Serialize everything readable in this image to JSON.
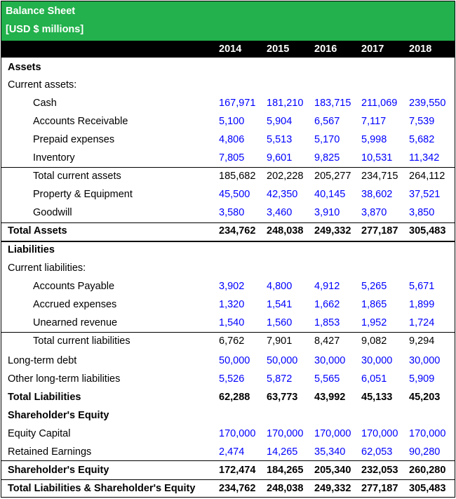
{
  "header": {
    "title": "Balance Sheet",
    "subtitle": "[USD $ millions]",
    "years": [
      "2014",
      "2015",
      "2016",
      "2017",
      "2018"
    ]
  },
  "rows": [
    {
      "label": "Assets",
      "indent": 0,
      "bold": true,
      "blue": false,
      "values": []
    },
    {
      "label": "Current assets:",
      "indent": 0,
      "bold": false,
      "blue": false,
      "values": []
    },
    {
      "label": "Cash",
      "indent": 2,
      "bold": false,
      "blue": true,
      "values": [
        "167,971",
        "181,210",
        "183,715",
        "211,069",
        "239,550"
      ]
    },
    {
      "label": "Accounts Receivable",
      "indent": 2,
      "bold": false,
      "blue": true,
      "values": [
        "5,100",
        "5,904",
        "6,567",
        "7,117",
        "7,539"
      ]
    },
    {
      "label": "Prepaid expenses",
      "indent": 2,
      "bold": false,
      "blue": true,
      "values": [
        "4,806",
        "5,513",
        "5,170",
        "5,998",
        "5,682"
      ]
    },
    {
      "label": "Inventory",
      "indent": 2,
      "bold": false,
      "blue": true,
      "values": [
        "7,805",
        "9,601",
        "9,825",
        "10,531",
        "11,342"
      ]
    },
    {
      "label": "Total current assets",
      "indent": 2,
      "bold": false,
      "blue": false,
      "values": [
        "185,682",
        "202,228",
        "205,277",
        "234,715",
        "264,112"
      ]
    },
    {
      "label": "Property & Equipment",
      "indent": 2,
      "bold": false,
      "blue": true,
      "values": [
        "45,500",
        "42,350",
        "40,145",
        "38,602",
        "37,521"
      ]
    },
    {
      "label": "Goodwill",
      "indent": 2,
      "bold": false,
      "blue": true,
      "values": [
        "3,580",
        "3,460",
        "3,910",
        "3,870",
        "3,850"
      ]
    },
    {
      "label": "Total Assets",
      "indent": 0,
      "bold": true,
      "blue": false,
      "values": [
        "234,762",
        "248,038",
        "249,332",
        "277,187",
        "305,483"
      ]
    },
    {
      "label": "Liabilities",
      "indent": 0,
      "bold": true,
      "blue": false,
      "values": []
    },
    {
      "label": "Current liabilities:",
      "indent": 0,
      "bold": false,
      "blue": false,
      "values": []
    },
    {
      "label": "Accounts Payable",
      "indent": 2,
      "bold": false,
      "blue": true,
      "values": [
        "3,902",
        "4,800",
        "4,912",
        "5,265",
        "5,671"
      ]
    },
    {
      "label": "Accrued expenses",
      "indent": 2,
      "bold": false,
      "blue": true,
      "values": [
        "1,320",
        "1,541",
        "1,662",
        "1,865",
        "1,899"
      ]
    },
    {
      "label": "Unearned revenue",
      "indent": 2,
      "bold": false,
      "blue": true,
      "values": [
        "1,540",
        "1,560",
        "1,853",
        "1,952",
        "1,724"
      ]
    },
    {
      "label": "Total current liabilities",
      "indent": 2,
      "bold": false,
      "blue": false,
      "values": [
        "6,762",
        "7,901",
        "8,427",
        "9,082",
        "9,294"
      ]
    },
    {
      "label": "Long-term debt",
      "indent": 0,
      "bold": false,
      "blue": true,
      "values": [
        "50,000",
        "50,000",
        "30,000",
        "30,000",
        "30,000"
      ]
    },
    {
      "label": "Other long-term liabilities",
      "indent": 0,
      "bold": false,
      "blue": true,
      "values": [
        "5,526",
        "5,872",
        "5,565",
        "6,051",
        "5,909"
      ]
    },
    {
      "label": "Total Liabilities",
      "indent": 0,
      "bold": true,
      "blue": false,
      "values": [
        "62,288",
        "63,773",
        "43,992",
        "45,133",
        "45,203"
      ]
    },
    {
      "label": "Shareholder's Equity",
      "indent": 0,
      "bold": true,
      "blue": false,
      "values": []
    },
    {
      "label": "Equity Capital",
      "indent": 0,
      "bold": false,
      "blue": true,
      "values": [
        "170,000",
        "170,000",
        "170,000",
        "170,000",
        "170,000"
      ]
    },
    {
      "label": "Retained Earnings",
      "indent": 0,
      "bold": false,
      "blue": true,
      "values": [
        "2,474",
        "14,265",
        "35,340",
        "62,053",
        "90,280"
      ]
    },
    {
      "label": "Shareholder's Equity",
      "indent": 0,
      "bold": true,
      "blue": false,
      "values": [
        "172,474",
        "184,265",
        "205,340",
        "232,053",
        "260,280"
      ]
    },
    {
      "label": "Total Liabilities & Shareholder's Equity",
      "indent": 0,
      "bold": true,
      "blue": false,
      "values": [
        "234,762",
        "248,038",
        "249,332",
        "277,187",
        "305,483"
      ]
    }
  ]
}
